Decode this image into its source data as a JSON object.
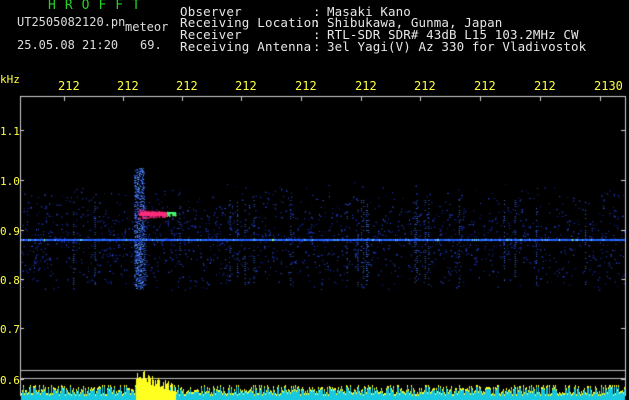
{
  "header": {
    "app_title": "HROFFT",
    "file_name": "UT2505082120.pn",
    "meteor_label": "meteor",
    "timestamp": "25.05.08 21:20",
    "count": "69."
  },
  "info": [
    {
      "label": "Observer",
      "value": "Masaki Kano"
    },
    {
      "label": "Receiving Location",
      "value": "Shibukawa, Gunma, Japan"
    },
    {
      "label": "Receiver",
      "value": "RTL-SDR SDR# 43dB L15 103.2MHz CW"
    },
    {
      "label": "Receiving Antenna",
      "value": "3el Yagi(V) Az 330 for Vladivostok"
    }
  ],
  "separator": ":",
  "axis": {
    "unit": "kHz",
    "x_ticks": [
      "212",
      "212",
      "212",
      "212",
      "212",
      "212",
      "212",
      "212",
      "212",
      "2130"
    ],
    "y_ticks": [
      "1.1",
      "1.0",
      "0.9",
      "0.8",
      "0.7",
      "0.6"
    ]
  },
  "colors": {
    "tick_label": "#ffff40",
    "title_green": "#22d422",
    "carrier": "#1e64ff",
    "noise": "#14286e",
    "meteor_head": "#ff2a7a",
    "bottom_bar": "#18c8e0",
    "meteor_bar": "#ffff20"
  }
}
